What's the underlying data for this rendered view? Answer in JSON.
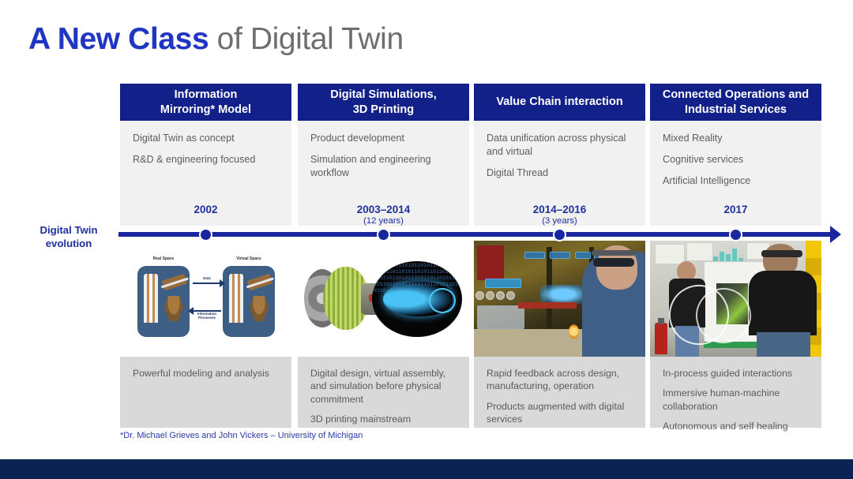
{
  "slide": {
    "title_accent": "A New Class",
    "title_rest": " of Digital Twin",
    "footnote": "*Dr. Michael Grieves and John Vickers – University of Michigan",
    "timeline_label_line1": "Digital Twin",
    "timeline_label_line2": "evolution",
    "colors": {
      "header_navy": "#122089",
      "accent_blue": "#1f35c4",
      "timeline_blue": "#1a26a0",
      "panel_light": "#f1f1f1",
      "panel_dark": "#d9d9d9",
      "bottom_bar": "#0b2352",
      "body_text": "#5d5d5d"
    }
  },
  "columns": [
    {
      "header_line1": "Information",
      "header_line2": "Mirroring* Model",
      "top_points": [
        "Digital Twin as concept",
        "R&D & engineering focused"
      ],
      "year": "2002",
      "year_sub": "",
      "image_caption": "real-space-virtual-space-diagram",
      "bottom_points": [
        "Powerful modeling and analysis"
      ]
    },
    {
      "header_line1": "Digital Simulations,",
      "header_line2": "3D Printing",
      "top_points": [
        "Product development",
        "Simulation and engineering workflow"
      ],
      "year": "2003–2014",
      "year_sub": "(12 years)",
      "image_caption": "jet-engine-digital-twin",
      "bottom_points": [
        "Digital design, virtual assembly, and simulation before physical commitment",
        "3D printing mainstream"
      ]
    },
    {
      "header_line1": "Value Chain interaction",
      "header_line2": "",
      "top_points": [
        "Data unification across physical and virtual",
        "Digital Thread"
      ],
      "year": "2014–2016",
      "year_sub": "(3 years)",
      "image_caption": "hololens-worker-ar-photo",
      "bottom_points": [
        "Rapid feedback across design, manufacturing, operation",
        "Products augmented with digital services"
      ]
    },
    {
      "header_line1": "Connected Operations and",
      "header_line2": "Industrial Services",
      "top_points": [
        "Mixed Reality",
        "Cognitive services",
        "Artificial Intelligence"
      ],
      "year": "2017",
      "year_sub": "",
      "image_caption": "technicians-ar-panel-photo",
      "bottom_points": [
        "In-process guided interactions",
        "Immersive human-machine collaboration",
        "Autonomous and self healing"
      ]
    }
  ],
  "diagram_labels": {
    "real_space": "Real Space",
    "virtual_space": "Virtual Space",
    "arrow_top": "Data",
    "arrow_bottom": "Information Processes"
  },
  "binary_texture": "1101011011010110101101101011010110110101101011011010110101101101011010110110101101011011010110101101101011010110"
}
